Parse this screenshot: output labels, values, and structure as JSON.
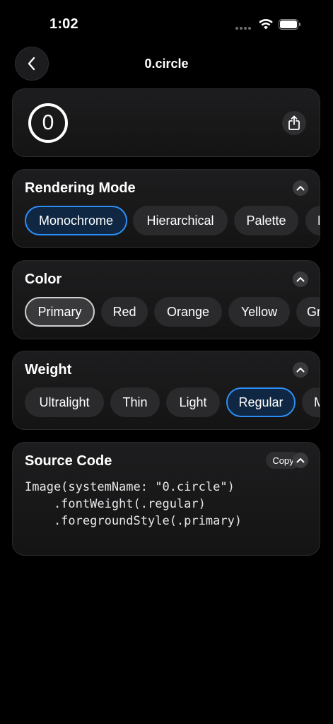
{
  "status_bar": {
    "time": "1:02"
  },
  "nav": {
    "title": "0.circle"
  },
  "preview": {
    "symbol_glyph": "0"
  },
  "rendering_mode": {
    "title": "Rendering Mode",
    "options": [
      "Monochrome",
      "Hierarchical",
      "Palette",
      "M"
    ],
    "selected": "Monochrome"
  },
  "color": {
    "title": "Color",
    "options": [
      "Primary",
      "Red",
      "Orange",
      "Yellow",
      "Gr"
    ],
    "selected": "Primary"
  },
  "weight": {
    "title": "Weight",
    "options": [
      "Ultralight",
      "Thin",
      "Light",
      "Regular",
      "M"
    ],
    "selected": "Regular"
  },
  "source_code": {
    "title": "Source Code",
    "copy_label": "Copy",
    "lines": [
      "Image(systemName: \"0.circle\")",
      "    .fontWeight(.regular)",
      "    .foregroundStyle(.primary)"
    ]
  },
  "colors": {
    "accent_blue": "#2c8ef5",
    "background": "#000000",
    "card": "#1c1c1e",
    "chip": "#2a2a2c"
  },
  "icons": [
    "chevron-left-icon",
    "share-icon",
    "chevron-up-icon",
    "wifi-icon",
    "battery-icon"
  ]
}
